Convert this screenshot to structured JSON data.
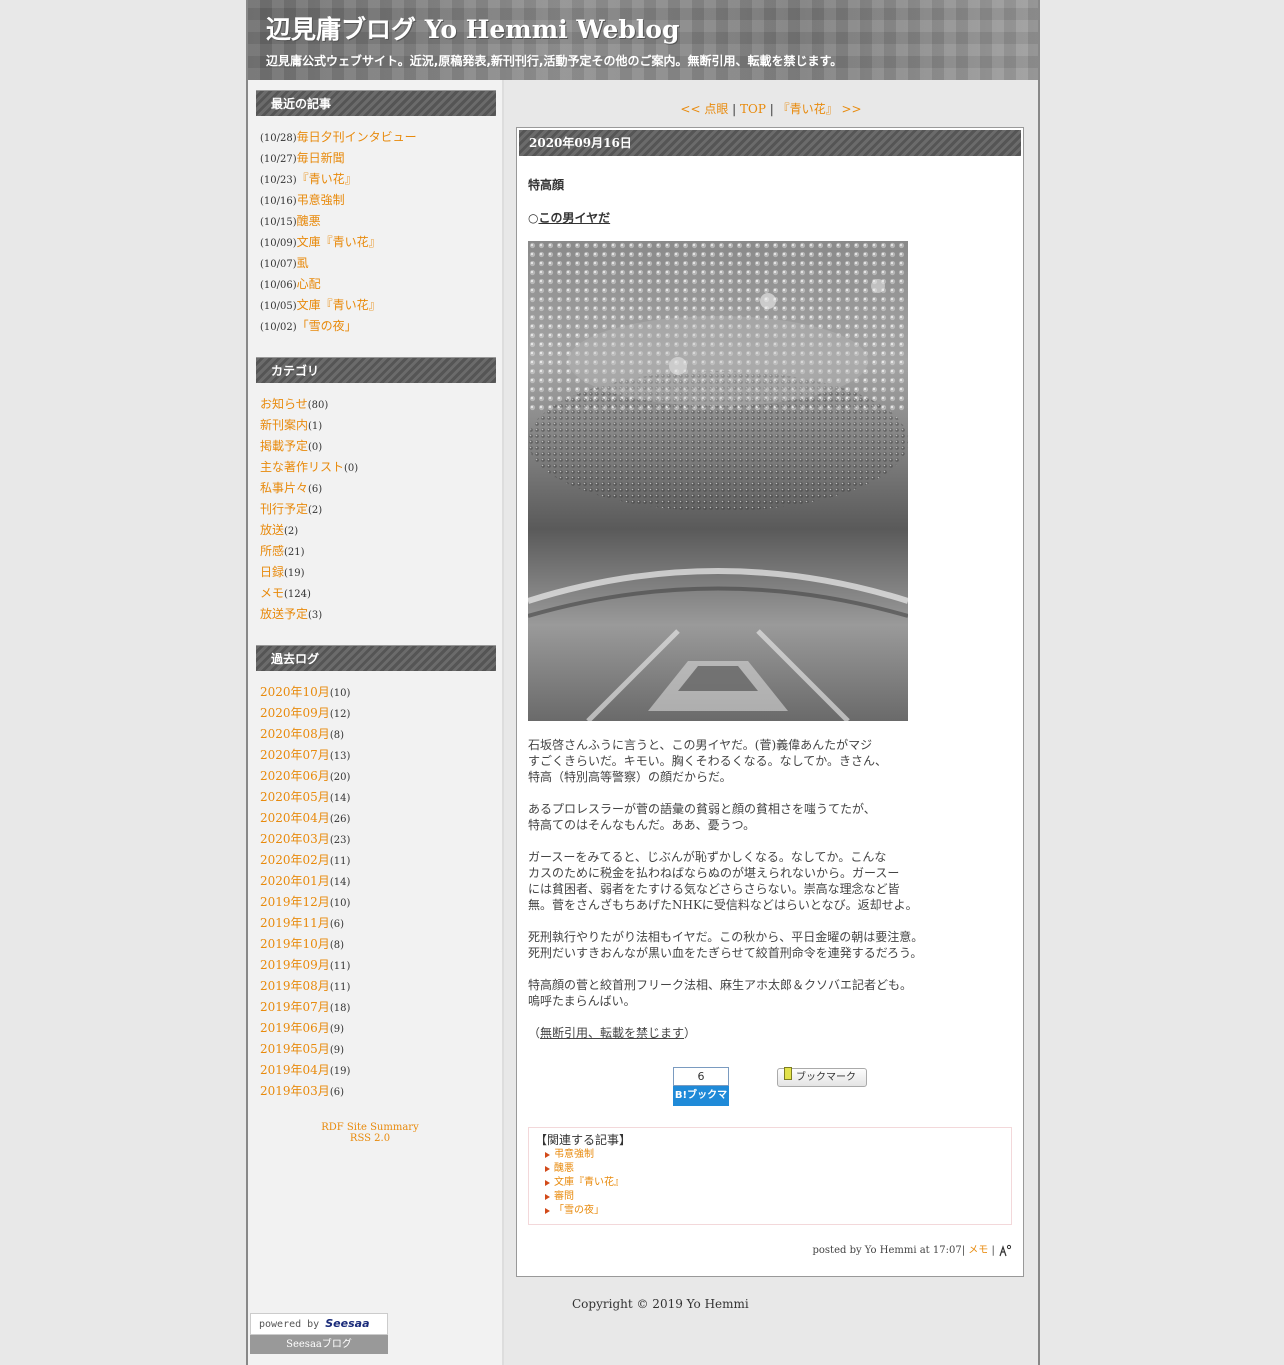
{
  "header": {
    "title": "辺見庸ブログ Yo Hemmi Weblog",
    "description": "辺見庸公式ウェブサイト。近況,原稿発表,新刊刊行,活動予定その他のご案内。無断引用、転載を禁じます。"
  },
  "sidebar": {
    "recent": {
      "heading": "最近の記事",
      "items": [
        {
          "date": "(10/28)",
          "title": "毎日夕刊インタビュー"
        },
        {
          "date": "(10/27)",
          "title": "毎日新聞"
        },
        {
          "date": "(10/23)",
          "title": "『青い花』"
        },
        {
          "date": "(10/16)",
          "title": "弔意強制"
        },
        {
          "date": "(10/15)",
          "title": "醜悪"
        },
        {
          "date": "(10/09)",
          "title": "文庫『青い花』"
        },
        {
          "date": "(10/07)",
          "title": "虱"
        },
        {
          "date": "(10/06)",
          "title": "心配"
        },
        {
          "date": "(10/05)",
          "title": "文庫『青い花』"
        },
        {
          "date": "(10/02)",
          "title": "「雪の夜」"
        }
      ]
    },
    "categories": {
      "heading": "カテゴリ",
      "items": [
        {
          "name": "お知らせ",
          "count": "(80)"
        },
        {
          "name": "新刊案内",
          "count": "(1)"
        },
        {
          "name": "掲載予定",
          "count": "(0)"
        },
        {
          "name": "主な著作リスト",
          "count": "(0)"
        },
        {
          "name": "私事片々",
          "count": "(6)"
        },
        {
          "name": "刊行予定",
          "count": "(2)"
        },
        {
          "name": "放送",
          "count": "(2)"
        },
        {
          "name": "所感",
          "count": "(21)"
        },
        {
          "name": "日録",
          "count": "(19)"
        },
        {
          "name": "メモ",
          "count": "(124)"
        },
        {
          "name": "放送予定",
          "count": "(3)"
        }
      ]
    },
    "archives": {
      "heading": "過去ログ",
      "items": [
        {
          "month": "2020年10月",
          "count": "(10)"
        },
        {
          "month": "2020年09月",
          "count": "(12)"
        },
        {
          "month": "2020年08月",
          "count": "(8)"
        },
        {
          "month": "2020年07月",
          "count": "(13)"
        },
        {
          "month": "2020年06月",
          "count": "(20)"
        },
        {
          "month": "2020年05月",
          "count": "(14)"
        },
        {
          "month": "2020年04月",
          "count": "(26)"
        },
        {
          "month": "2020年03月",
          "count": "(23)"
        },
        {
          "month": "2020年02月",
          "count": "(11)"
        },
        {
          "month": "2020年01月",
          "count": "(14)"
        },
        {
          "month": "2019年12月",
          "count": "(10)"
        },
        {
          "month": "2019年11月",
          "count": "(6)"
        },
        {
          "month": "2019年10月",
          "count": "(8)"
        },
        {
          "month": "2019年09月",
          "count": "(11)"
        },
        {
          "month": "2019年08月",
          "count": "(11)"
        },
        {
          "month": "2019年07月",
          "count": "(18)"
        },
        {
          "month": "2019年06月",
          "count": "(9)"
        },
        {
          "month": "2019年05月",
          "count": "(9)"
        },
        {
          "month": "2019年04月",
          "count": "(19)"
        },
        {
          "month": "2019年03月",
          "count": "(6)"
        }
      ]
    },
    "rdf": "RDF Site Summary",
    "rss": "RSS 2.0",
    "powered_prefix": "powered by",
    "powered_brand": "Seesaa",
    "powered_link": "Seesaaブログ"
  },
  "nav": {
    "prev": "<< 点眼",
    "sep1": "|",
    "top": "TOP",
    "sep2": "|",
    "next": "『青い花』 >>"
  },
  "entry": {
    "date": "2020年09月16日",
    "title": "特高顔",
    "subtitle_prefix": "○",
    "subtitle_link": "この男イヤだ",
    "paragraphs": [
      [
        "石坂啓さんふうに言うと、この男イヤだ。(菅)義偉あんたがマジ",
        "すごくきらいだ。キモい。胸くそわるくなる。なしてか。きさん、",
        "特高（特別高等警察）の顔だからだ。"
      ],
      [
        "あるプロレスラーが菅の語彙の貧弱と顔の貧相さを嗤うてたが、",
        "特高てのはそんなもんだ。ああ、憂うつ。"
      ],
      [
        "ガースーをみてると、じぶんが恥ずかしくなる。なしてか。こんな",
        "カスのために税金を払わねばならぬのが堪えられないから。ガースー",
        "には貧困者、弱者をたすける気などさらさらない。崇高な理念など皆",
        "無。菅をさんざもちあげたNHKに受信料などはらいとなび。返却せよ。"
      ],
      [
        "死刑執行やりたがり法相もイヤだ。この秋から、平日金曜の朝は要注意。",
        "死刑だいすきおんなが黒い血をたぎらせて絞首刑命令を連発するだろう。"
      ],
      [
        "特高顔の菅と絞首刑フリーク法相、麻生アホ太郎＆クソバエ記者ども。",
        "嗚呼たまらんばい。"
      ]
    ],
    "notice_open": "（",
    "notice_link": "無断引用、転載を禁じます",
    "notice_close": "）",
    "hatena_count": "6",
    "hatena_label": "B!ブックマーク",
    "bookmark_label": "ブックマーク",
    "related_title": "【関連する記事】",
    "related": [
      "弔意強制",
      "醜悪",
      "文庫『青い花』",
      "審問",
      "「雪の夜」"
    ],
    "posted_by": "posted by Yo Hemmi at 17:07|",
    "category": "メモ",
    "sep": "|"
  },
  "footer": {
    "copyright": "Copyright © 2019 Yo Hemmi"
  },
  "colors": {
    "link": "#e88a0c",
    "header_bar": "#5e5e5e",
    "hatena_blue": "#1f8ad8"
  }
}
